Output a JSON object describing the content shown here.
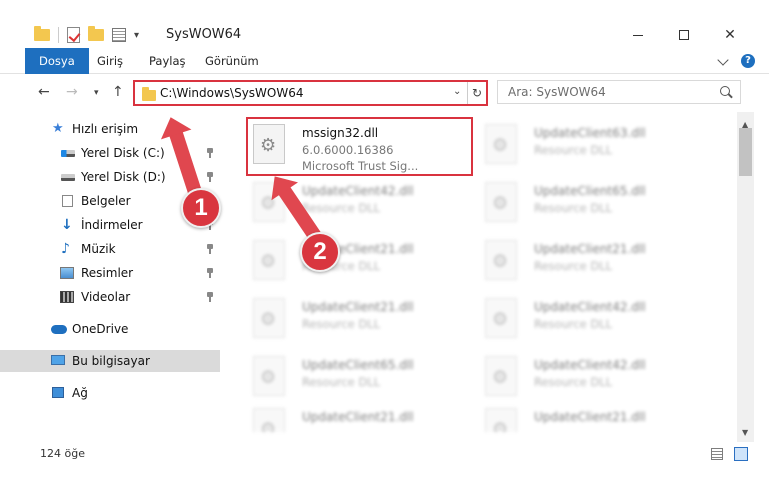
{
  "window": {
    "title": "SysWOW64",
    "qat_dropdown": "▾"
  },
  "ribbon": {
    "tabs": [
      "Dosya",
      "Giriş",
      "Paylaş",
      "Görünüm"
    ]
  },
  "nav": {
    "back": "←",
    "forward": "→",
    "recent": "▾",
    "up": "↑",
    "address": "C:\\Windows\\SysWOW64",
    "address_dropdown": "⌄",
    "refresh": "↻",
    "search_placeholder": "Ara: SysWOW64"
  },
  "navpane": {
    "items": [
      {
        "label": "Hızlı erişim",
        "icon": "star-icon",
        "pinned": false
      },
      {
        "label": "Yerel Disk (C:)",
        "icon": "drive-icon",
        "pinned": true
      },
      {
        "label": "Yerel Disk (D:)",
        "icon": "drive-icon",
        "pinned": true
      },
      {
        "label": "Belgeler",
        "icon": "documents-icon",
        "pinned": true
      },
      {
        "label": "İndirmeler",
        "icon": "download-icon",
        "pinned": true
      },
      {
        "label": "Müzik",
        "icon": "music-icon",
        "pinned": true
      },
      {
        "label": "Resimler",
        "icon": "pictures-icon",
        "pinned": true
      },
      {
        "label": "Videolar",
        "icon": "videos-icon",
        "pinned": true
      },
      {
        "label": "OneDrive",
        "icon": "cloud-icon",
        "pinned": false
      },
      {
        "label": "Bu bilgisayar",
        "icon": "computer-icon",
        "pinned": false,
        "selected": true
      },
      {
        "label": "Ağ",
        "icon": "network-icon",
        "pinned": false
      }
    ]
  },
  "files": [
    {
      "name": "mssign32.dll",
      "line1": "6.0.6000.16386",
      "line2": "Microsoft Trust Sig..."
    },
    {
      "name": "UpdateClient63.dll",
      "line1": "Resource DLL",
      "line2": ""
    },
    {
      "name": "UpdateClient42.dll",
      "line1": "Resource DLL",
      "line2": ""
    },
    {
      "name": "UpdateClient65.dll",
      "line1": "Resource DLL",
      "line2": ""
    },
    {
      "name": "UpdateClient21.dll",
      "line1": "Resource DLL",
      "line2": ""
    },
    {
      "name": "UpdateClient21.dll",
      "line1": "Resource DLL",
      "line2": ""
    },
    {
      "name": "UpdateClient21.dll",
      "line1": "Resource DLL",
      "line2": ""
    },
    {
      "name": "UpdateClient42.dll",
      "line1": "Resource DLL",
      "line2": ""
    },
    {
      "name": "UpdateClient65.dll",
      "line1": "Resource DLL",
      "line2": ""
    },
    {
      "name": "UpdateClient42.dll",
      "line1": "Resource DLL",
      "line2": ""
    },
    {
      "name": "UpdateClient21.dll",
      "line1": "Resource DLL",
      "line2": ""
    },
    {
      "name": "UpdateClient21.dll",
      "line1": "Resource DLL",
      "line2": ""
    }
  ],
  "scrollbar": {
    "up": "▲",
    "down": "▼"
  },
  "status": {
    "item_count": "124 öğe"
  },
  "annotations": {
    "badge1": "1",
    "badge2": "2",
    "color": "#d9363f"
  },
  "colors": {
    "accent": "#1e6fbf",
    "highlight": "#d9333f"
  }
}
